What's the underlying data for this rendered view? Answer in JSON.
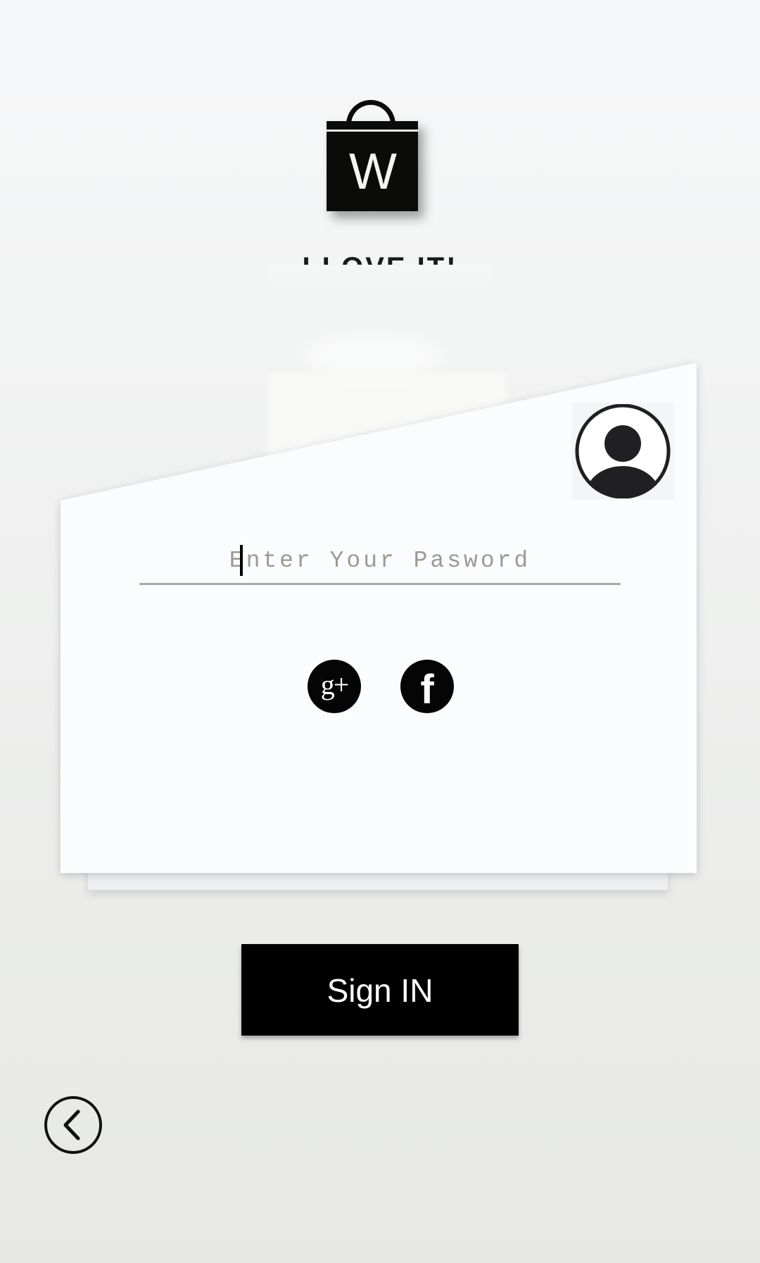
{
  "brand": {
    "logo_letter": "W",
    "tagline": "I LOVE IT!"
  },
  "login": {
    "password_placeholder": "Enter Your Pasword",
    "password_value": ""
  },
  "social": {
    "google_plus_label": "g+",
    "facebook_label": "f"
  },
  "actions": {
    "sign_in_label": "Sign IN"
  },
  "icons": {
    "logo": "shopping-bag-icon",
    "avatar": "user-circle-icon",
    "google_plus": "google-plus-icon",
    "facebook": "facebook-icon",
    "back": "chevron-left-circle-icon"
  },
  "colors": {
    "primary": "#000000",
    "card": "#fbfcfe",
    "divider": "#a9aaa8",
    "placeholder": "#9c9a92"
  }
}
